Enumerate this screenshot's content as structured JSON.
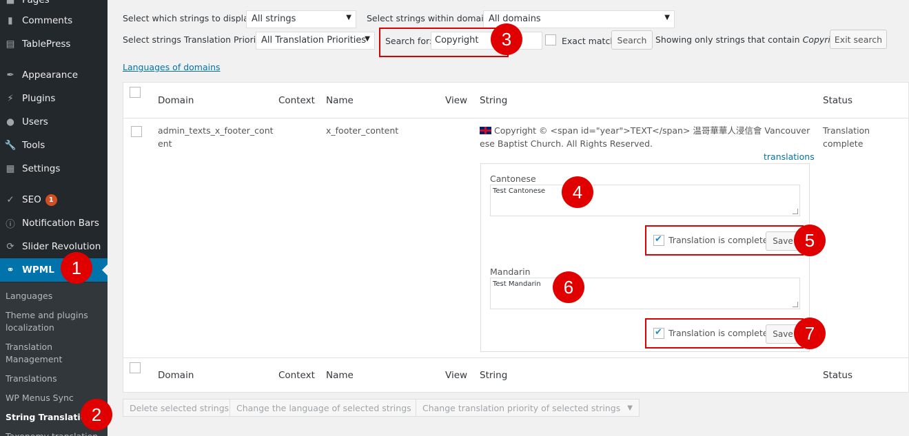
{
  "sidebar": {
    "menu": [
      {
        "label": "Pages",
        "icon": "pages-icon"
      },
      {
        "label": "Comments",
        "icon": "comments-icon"
      },
      {
        "label": "TablePress",
        "icon": "tablepress-icon"
      },
      {
        "label": "Appearance",
        "icon": "appearance-icon"
      },
      {
        "label": "Plugins",
        "icon": "plugins-icon"
      },
      {
        "label": "Users",
        "icon": "users-icon"
      },
      {
        "label": "Tools",
        "icon": "tools-icon"
      },
      {
        "label": "Settings",
        "icon": "settings-icon"
      },
      {
        "label": "SEO",
        "icon": "seo-icon",
        "badge": "1"
      },
      {
        "label": "Notification Bars",
        "icon": "info-icon"
      },
      {
        "label": "Slider Revolution",
        "icon": "refresh-icon"
      },
      {
        "label": "WPML",
        "icon": "wpml-icon"
      }
    ],
    "submenu": [
      "Languages",
      "Theme and plugins localization",
      "Translation Management",
      "Translations",
      "WP Menus Sync",
      "String Translation",
      "Taxonomy translation"
    ]
  },
  "filters": {
    "display_label": "Select which strings to display:",
    "display_value": "All strings",
    "domain_label": "Select strings within domain:",
    "domain_value": "All domains",
    "priority_label": "Select strings Translation Priority:",
    "priority_value": "All Translation Priorities",
    "search_label": "Search for:",
    "search_value": "Copyright",
    "exact_match_label": "Exact match",
    "search_button": "Search",
    "showing_prefix": "Showing only strings that contain",
    "showing_term": "Copyright",
    "exit_search_button": "Exit search",
    "languages_link": "Languages of domains"
  },
  "table": {
    "headers": {
      "domain": "Domain",
      "context": "Context",
      "name": "Name",
      "view": "View",
      "string": "String",
      "status": "Status"
    },
    "row": {
      "domain_line1": "admin_texts_x_footer_cont",
      "domain_line2": "ent",
      "name": "x_footer_content",
      "string_line1": "Copyright © <span id=\"year\">TEXT</span> 温哥華華人浸信會 Vancouver Chin",
      "string_line2": "ese Baptist Church. All Rights Reserved.",
      "status": "Translation complete",
      "translations_link": "translations",
      "translations": [
        {
          "language": "Cantonese",
          "text": "Test Cantonese",
          "complete_label": "Translation is complete",
          "save": "Save"
        },
        {
          "language": "Mandarin",
          "text": "Test Mandarin",
          "complete_label": "Translation is complete",
          "save": "Save"
        }
      ]
    }
  },
  "bulk": {
    "delete": "Delete selected strings",
    "change_language": "Change the language of selected strings",
    "change_priority": "Change translation priority of selected strings"
  },
  "callouts": [
    "1",
    "2",
    "3",
    "4",
    "5",
    "6",
    "7"
  ],
  "colors": {
    "sidebar_bg": "#23282d",
    "active": "#0073aa",
    "callout": "#e00000",
    "link": "#0073aa"
  }
}
